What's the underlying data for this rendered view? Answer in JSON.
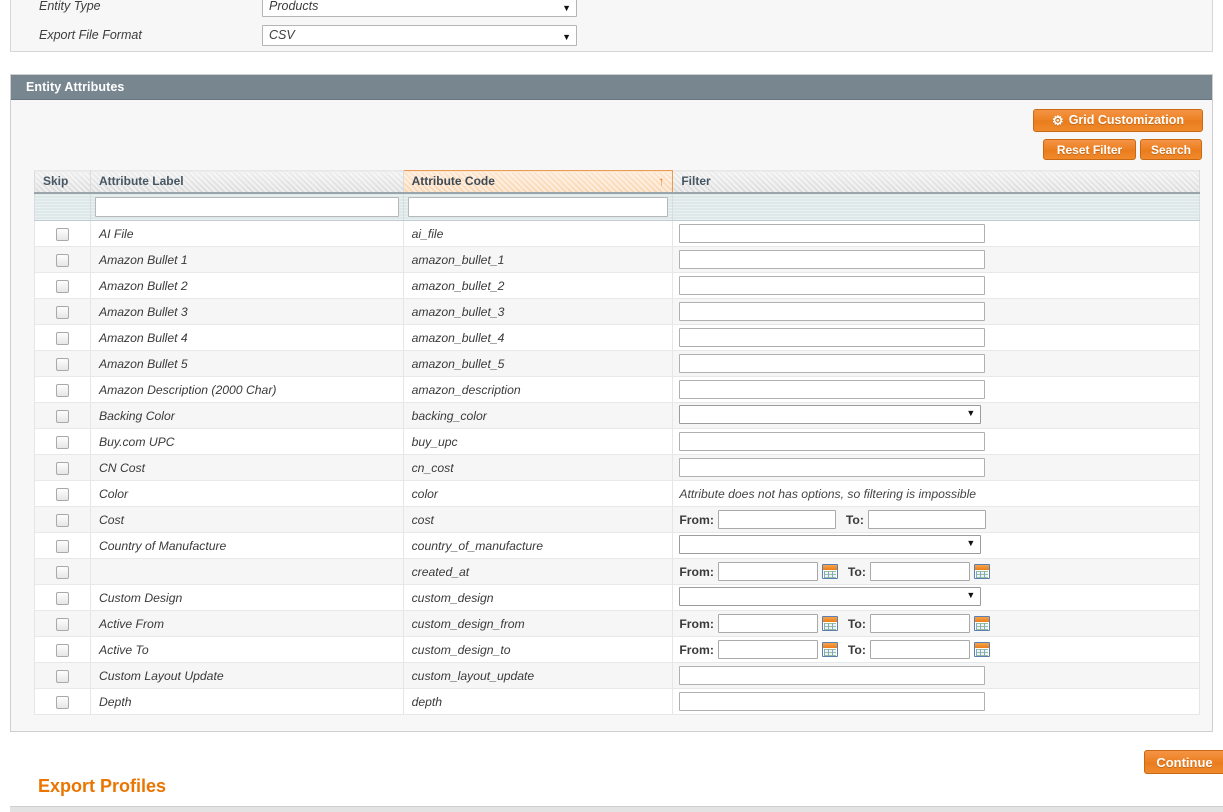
{
  "form": {
    "rows": [
      {
        "label": "Entity Type",
        "value": "Products",
        "caret": "▼"
      },
      {
        "label": "Export File Format",
        "value": "CSV",
        "caret": "▼"
      }
    ]
  },
  "panel": {
    "title": "Entity Attributes"
  },
  "toolbar": {
    "grid_customization": "Grid Customization",
    "gear_icon": "⚙",
    "reset_filter": "Reset Filter",
    "search": "Search",
    "continue": "Continue"
  },
  "grid": {
    "columns": [
      {
        "key": "skip",
        "label": "Skip",
        "sorted": false
      },
      {
        "key": "label",
        "label": "Attribute Label",
        "sorted": false
      },
      {
        "key": "code",
        "label": "Attribute Code",
        "sorted": true
      },
      {
        "key": "filter",
        "label": "Filter",
        "sorted": false
      }
    ],
    "sort_arrow": "↑",
    "filter_row": {
      "label_value": "",
      "code_value": "",
      "label_placeholder": "",
      "code_placeholder": ""
    },
    "range_labels": {
      "from": "From:",
      "to": "To:"
    },
    "select_caret": "▼",
    "no_options_note": "Attribute does not has options, so filtering is impossible",
    "rows": [
      {
        "label": "AI File",
        "code": "ai_file",
        "filter": "text"
      },
      {
        "label": "Amazon Bullet 1",
        "code": "amazon_bullet_1",
        "filter": "text"
      },
      {
        "label": "Amazon Bullet 2",
        "code": "amazon_bullet_2",
        "filter": "text"
      },
      {
        "label": "Amazon Bullet 3",
        "code": "amazon_bullet_3",
        "filter": "text"
      },
      {
        "label": "Amazon Bullet 4",
        "code": "amazon_bullet_4",
        "filter": "text"
      },
      {
        "label": "Amazon Bullet 5",
        "code": "amazon_bullet_5",
        "filter": "text"
      },
      {
        "label": "Amazon Description (2000 Char)",
        "code": "amazon_description",
        "filter": "text"
      },
      {
        "label": "Backing Color",
        "code": "backing_color",
        "filter": "select"
      },
      {
        "label": "Buy.com UPC",
        "code": "buy_upc",
        "filter": "text"
      },
      {
        "label": "CN Cost",
        "code": "cn_cost",
        "filter": "text"
      },
      {
        "label": "Color",
        "code": "color",
        "filter": "note"
      },
      {
        "label": "Cost",
        "code": "cost",
        "filter": "range"
      },
      {
        "label": "Country of Manufacture",
        "code": "country_of_manufacture",
        "filter": "select"
      },
      {
        "label": "",
        "code": "created_at",
        "filter": "daterange"
      },
      {
        "label": "Custom Design",
        "code": "custom_design",
        "filter": "select"
      },
      {
        "label": "Active From",
        "code": "custom_design_from",
        "filter": "daterange"
      },
      {
        "label": "Active To",
        "code": "custom_design_to",
        "filter": "daterange"
      },
      {
        "label": "Custom Layout Update",
        "code": "custom_layout_update",
        "filter": "text"
      },
      {
        "label": "Depth",
        "code": "depth",
        "filter": "text"
      }
    ]
  },
  "bottom": {
    "export_profiles_title": "Export Profiles"
  }
}
